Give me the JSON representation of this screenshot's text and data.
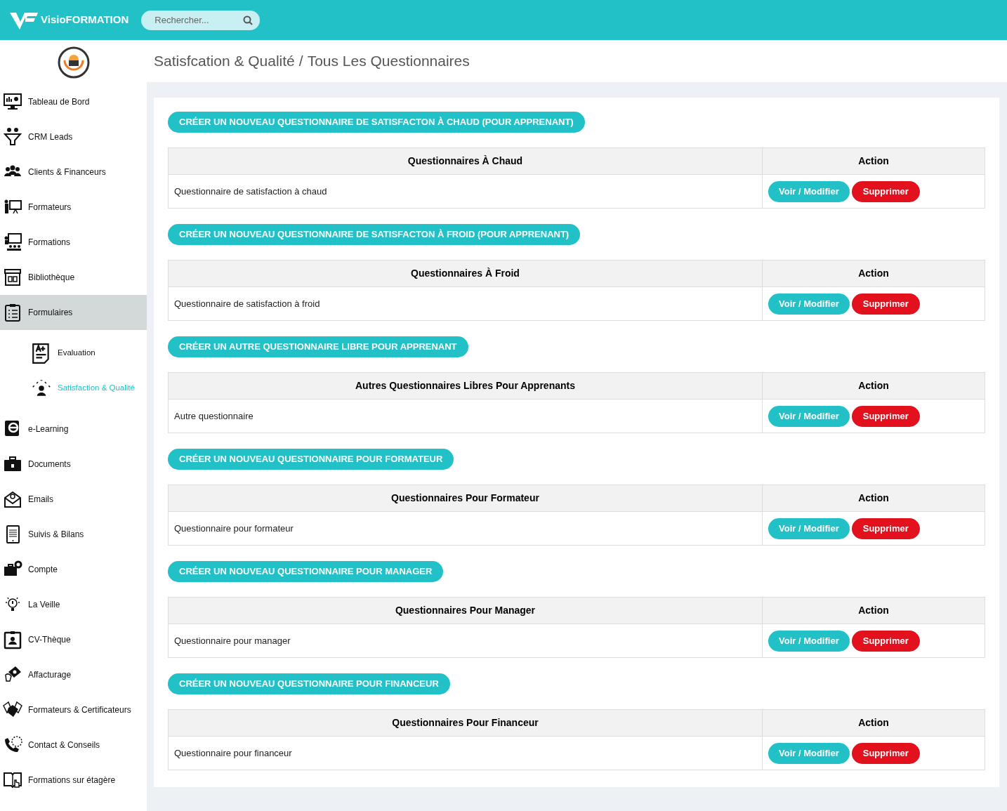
{
  "header": {
    "brand": "VisioFORMATION",
    "search": {
      "placeholder": "Rechercher..."
    }
  },
  "sidebar": {
    "items": [
      {
        "label": "Tableau de Bord",
        "selected": false
      },
      {
        "label": "CRM Leads",
        "selected": false
      },
      {
        "label": "Clients & Financeurs",
        "selected": false
      },
      {
        "label": "Formateurs",
        "selected": false
      },
      {
        "label": "Formations",
        "selected": false
      },
      {
        "label": "Bibliothèque",
        "selected": false
      },
      {
        "label": "Formulaires",
        "selected": true,
        "expanded": true,
        "children": [
          {
            "label": "Evaluation",
            "selected": false
          },
          {
            "label": "Satisfaction & Qualité",
            "selected": true
          }
        ]
      },
      {
        "label": "e-Learning",
        "selected": false
      },
      {
        "label": "Documents",
        "selected": false
      },
      {
        "label": "Emails",
        "selected": false
      },
      {
        "label": "Suivis & Bilans",
        "selected": false
      },
      {
        "label": "Compte",
        "selected": false
      },
      {
        "label": "La Veille",
        "selected": false
      },
      {
        "label": "CV-Thèque",
        "selected": false
      },
      {
        "label": "Affacturage",
        "selected": false
      },
      {
        "label": "Formateurs & Certificateurs",
        "selected": false
      },
      {
        "label": "Contact & Conseils",
        "selected": false
      },
      {
        "label": "Formations sur étagère",
        "selected": false
      }
    ]
  },
  "breadcrumb": [
    "Satisfcation & Qualité",
    "/",
    "Tous Les Questionnaires"
  ],
  "sections": [
    {
      "create_button": "CRÉER UN NOUVEAU QUESTIONNAIRE DE SATISFACTON À CHAUD (POUR APPRENANT)",
      "columns": [
        "Questionnaires À Chaud",
        "Action"
      ],
      "rows": [
        {
          "name": "Questionnaire de satisfaction à chaud",
          "edit": "Voir / Modifier",
          "delete": "Supprimer"
        }
      ]
    },
    {
      "create_button": "CRÉER UN NOUVEAU QUESTIONNAIRE DE SATISFACTON À FROID (POUR APPRENANT)",
      "columns": [
        "Questionnaires À Froid",
        "Action"
      ],
      "rows": [
        {
          "name": "Questionnaire de satisfaction à froid",
          "edit": "Voir / Modifier",
          "delete": "Supprimer"
        }
      ]
    },
    {
      "create_button": "CRÉER UN AUTRE QUESTIONNAIRE LIBRE POUR APPRENANT",
      "columns": [
        "Autres Questionnaires Libres Pour Apprenants",
        "Action"
      ],
      "rows": [
        {
          "name": "Autre questionnaire",
          "edit": "Voir / Modifier",
          "delete": "Supprimer"
        }
      ]
    },
    {
      "create_button": "CRÉER UN NOUVEAU QUESTIONNAIRE POUR FORMATEUR",
      "columns": [
        "Questionnaires Pour Formateur",
        "Action"
      ],
      "rows": [
        {
          "name": "Questionnaire pour formateur",
          "edit": "Voir / Modifier",
          "delete": "Supprimer"
        }
      ]
    },
    {
      "create_button": "CRÉER UN NOUVEAU QUESTIONNAIRE POUR MANAGER",
      "columns": [
        "Questionnaires Pour Manager",
        "Action"
      ],
      "rows": [
        {
          "name": "Questionnaire pour manager",
          "edit": "Voir / Modifier",
          "delete": "Supprimer"
        }
      ]
    },
    {
      "create_button": "CRÉER UN NOUVEAU QUESTIONNAIRE POUR FINANCEUR",
      "columns": [
        "Questionnaires Pour Financeur",
        "Action"
      ],
      "rows": [
        {
          "name": "Questionnaire pour financeur",
          "edit": "Voir / Modifier",
          "delete": "Supprimer"
        }
      ]
    }
  ]
}
